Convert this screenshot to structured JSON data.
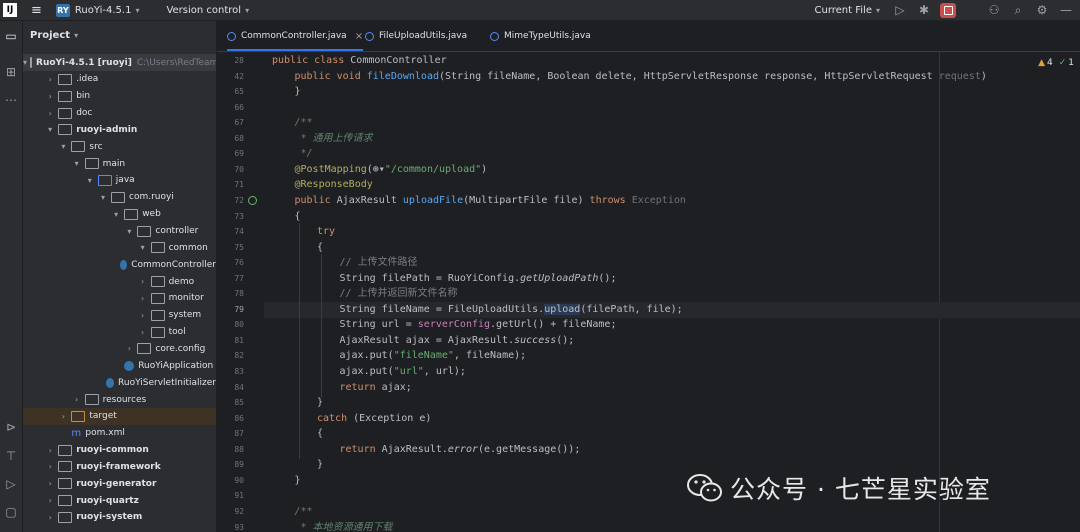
{
  "titlebar": {
    "logo": "IJ",
    "project_badge": "RY",
    "project_name": "RuoYi-4.5.1",
    "version_control": "Version control",
    "run_config": "Current File",
    "icons": [
      "run-icon",
      "debug-icon",
      "stop-icon",
      "add-user-icon",
      "search-icon",
      "settings-icon",
      "minimize-icon"
    ]
  },
  "project_panel": {
    "title": "Project",
    "tree": [
      {
        "indent": 0,
        "arrow": "v",
        "icon": "folder",
        "label": "RuoYi-4.5.1 [ruoyi]",
        "hint": "C:\\Users\\RedTeam",
        "bold": true,
        "selected": true
      },
      {
        "indent": 1,
        "arrow": ">",
        "icon": "folder",
        "label": ".idea"
      },
      {
        "indent": 1,
        "arrow": ">",
        "icon": "folder",
        "label": "bin"
      },
      {
        "indent": 1,
        "arrow": ">",
        "icon": "folder",
        "label": "doc"
      },
      {
        "indent": 1,
        "arrow": "v",
        "icon": "folder",
        "label": "ruoyi-admin",
        "bold": true
      },
      {
        "indent": 2,
        "arrow": "v",
        "icon": "folder",
        "label": "src"
      },
      {
        "indent": 3,
        "arrow": "v",
        "icon": "folder",
        "label": "main"
      },
      {
        "indent": 4,
        "arrow": "v",
        "icon": "folder-blue",
        "label": "java"
      },
      {
        "indent": 5,
        "arrow": "v",
        "icon": "folder",
        "label": "com.ruoyi"
      },
      {
        "indent": 6,
        "arrow": "v",
        "icon": "folder",
        "label": "web"
      },
      {
        "indent": 7,
        "arrow": "v",
        "icon": "folder",
        "label": "controller"
      },
      {
        "indent": 8,
        "arrow": "v",
        "icon": "folder",
        "label": "common"
      },
      {
        "indent": 9,
        "arrow": "",
        "icon": "class",
        "label": "CommonController"
      },
      {
        "indent": 8,
        "arrow": ">",
        "icon": "folder",
        "label": "demo"
      },
      {
        "indent": 8,
        "arrow": ">",
        "icon": "folder",
        "label": "monitor"
      },
      {
        "indent": 8,
        "arrow": ">",
        "icon": "folder",
        "label": "system"
      },
      {
        "indent": 8,
        "arrow": ">",
        "icon": "folder",
        "label": "tool"
      },
      {
        "indent": 7,
        "arrow": ">",
        "icon": "folder",
        "label": "core.config"
      },
      {
        "indent": 6,
        "arrow": "",
        "icon": "class",
        "label": "RuoYiApplication"
      },
      {
        "indent": 6,
        "arrow": "",
        "icon": "class",
        "label": "RuoYiServletInitializer"
      },
      {
        "indent": 3,
        "arrow": ">",
        "icon": "folder",
        "label": "resources"
      },
      {
        "indent": 2,
        "arrow": ">",
        "icon": "folder-orange",
        "label": "target",
        "excluded": true
      },
      {
        "indent": 2,
        "arrow": "",
        "icon": "xml",
        "label": "pom.xml"
      },
      {
        "indent": 1,
        "arrow": ">",
        "icon": "folder",
        "label": "ruoyi-common",
        "bold": true
      },
      {
        "indent": 1,
        "arrow": ">",
        "icon": "folder",
        "label": "ruoyi-framework",
        "bold": true
      },
      {
        "indent": 1,
        "arrow": ">",
        "icon": "folder",
        "label": "ruoyi-generator",
        "bold": true
      },
      {
        "indent": 1,
        "arrow": ">",
        "icon": "folder",
        "label": "ruoyi-quartz",
        "bold": true
      },
      {
        "indent": 1,
        "arrow": ">",
        "icon": "folder",
        "label": "ruoyi-system",
        "bold": true
      }
    ]
  },
  "tabs": [
    {
      "label": "CommonController.java",
      "active": true,
      "closable": true
    },
    {
      "label": "FileUploadUtils.java",
      "active": false
    },
    {
      "label": "MimeTypeUtils.java",
      "active": false
    }
  ],
  "editor": {
    "warnings": "4",
    "checks": "1",
    "lines": [
      {
        "n": "28",
        "indent": 0,
        "tokens": [
          [
            "k",
            "public class "
          ],
          [
            "",
            "CommonController"
          ]
        ]
      },
      {
        "n": "42",
        "indent": 1,
        "tokens": [
          [
            "k",
            "public void "
          ],
          [
            "fn",
            "fileDownload"
          ],
          [
            "",
            "(String fileName, Boolean delete, HttpServletResponse response, HttpServletRequest "
          ],
          [
            "gr",
            "request"
          ],
          [
            "",
            ")"
          ]
        ]
      },
      {
        "n": "65",
        "indent": 1,
        "tokens": [
          [
            "",
            "}"
          ]
        ]
      },
      {
        "n": "66",
        "indent": 0,
        "tokens": []
      },
      {
        "n": "67",
        "indent": 1,
        "tokens": [
          [
            "cd",
            "/**"
          ]
        ]
      },
      {
        "n": "68",
        "indent": 1,
        "tokens": [
          [
            "cd",
            " * 通用上传请求"
          ]
        ]
      },
      {
        "n": "69",
        "indent": 1,
        "tokens": [
          [
            "cd",
            " */"
          ]
        ]
      },
      {
        "n": "70",
        "indent": 1,
        "tokens": [
          [
            "an",
            "@PostMapping"
          ],
          [
            "",
            "(⊕▾"
          ],
          [
            "s",
            "\"/common/upload\""
          ],
          [
            "",
            ")"
          ]
        ]
      },
      {
        "n": "71",
        "indent": 1,
        "tokens": [
          [
            "an",
            "@ResponseBody"
          ]
        ]
      },
      {
        "n": "72",
        "indent": 1,
        "tokens": [
          [
            "k",
            "public "
          ],
          [
            "",
            "AjaxResult "
          ],
          [
            "fn",
            "uploadFile"
          ],
          [
            "",
            "(MultipartFile file) "
          ],
          [
            "k",
            "throws "
          ],
          [
            "gr",
            "Exception"
          ]
        ]
      },
      {
        "n": "73",
        "indent": 1,
        "tokens": [
          [
            "",
            "{"
          ]
        ]
      },
      {
        "n": "74",
        "indent": 2,
        "tokens": [
          [
            "k",
            "try"
          ]
        ]
      },
      {
        "n": "75",
        "indent": 2,
        "tokens": [
          [
            "",
            "{"
          ]
        ]
      },
      {
        "n": "76",
        "indent": 3,
        "tokens": [
          [
            "c",
            "// 上传文件路径"
          ]
        ]
      },
      {
        "n": "77",
        "indent": 3,
        "tokens": [
          [
            "",
            "String filePath = RuoYiConfig."
          ],
          [
            "it",
            "getUploadPath"
          ],
          [
            "",
            "();"
          ]
        ]
      },
      {
        "n": "78",
        "indent": 3,
        "tokens": [
          [
            "c",
            "// 上传并返回新文件名称"
          ]
        ]
      },
      {
        "n": "79",
        "indent": 3,
        "tokens": [
          [
            "",
            "String fileName = FileUploadUtils."
          ],
          [
            "hl",
            "upload"
          ],
          [
            "",
            "(filePath, file);"
          ]
        ]
      },
      {
        "n": "80",
        "indent": 3,
        "tokens": [
          [
            "",
            "String url = "
          ],
          [
            "pp",
            "serverConfig"
          ],
          [
            "",
            ".getUrl() + fileName;"
          ]
        ]
      },
      {
        "n": "81",
        "indent": 3,
        "tokens": [
          [
            "",
            "AjaxResult ajax = AjaxResult."
          ],
          [
            "it",
            "success"
          ],
          [
            "",
            "();"
          ]
        ]
      },
      {
        "n": "82",
        "indent": 3,
        "tokens": [
          [
            "",
            "ajax.put("
          ],
          [
            "s",
            "\"fileName\""
          ],
          [
            "",
            ", fileName);"
          ]
        ]
      },
      {
        "n": "83",
        "indent": 3,
        "tokens": [
          [
            "",
            "ajax.put("
          ],
          [
            "s",
            "\"url\""
          ],
          [
            "",
            ", url);"
          ]
        ]
      },
      {
        "n": "84",
        "indent": 3,
        "tokens": [
          [
            "k",
            "return "
          ],
          [
            "",
            "ajax;"
          ]
        ]
      },
      {
        "n": "85",
        "indent": 2,
        "tokens": [
          [
            "",
            "}"
          ]
        ]
      },
      {
        "n": "86",
        "indent": 2,
        "tokens": [
          [
            "k",
            "catch "
          ],
          [
            "",
            "(Exception e)"
          ]
        ]
      },
      {
        "n": "87",
        "indent": 2,
        "tokens": [
          [
            "",
            "{"
          ]
        ]
      },
      {
        "n": "88",
        "indent": 3,
        "tokens": [
          [
            "k",
            "return "
          ],
          [
            "",
            "AjaxResult."
          ],
          [
            "it",
            "error"
          ],
          [
            "",
            "(e.getMessage());"
          ]
        ]
      },
      {
        "n": "89",
        "indent": 2,
        "tokens": [
          [
            "",
            "}"
          ]
        ]
      },
      {
        "n": "90",
        "indent": 1,
        "tokens": [
          [
            "",
            "}"
          ]
        ]
      },
      {
        "n": "91",
        "indent": 0,
        "tokens": []
      },
      {
        "n": "92",
        "indent": 1,
        "tokens": [
          [
            "cd",
            "/**"
          ]
        ]
      },
      {
        "n": "93",
        "indent": 1,
        "tokens": [
          [
            "cd",
            " * 本地资源通用下载"
          ]
        ]
      }
    ],
    "current_line": "79",
    "gutter_marker_line": "72"
  },
  "watermark": {
    "text": "公众号 · 七芒星实验室"
  }
}
